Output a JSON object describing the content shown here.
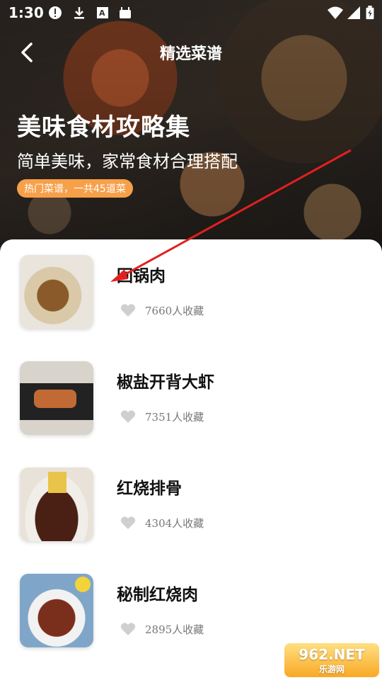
{
  "status_bar": {
    "time": "1:30"
  },
  "header": {
    "title": "精选菜谱",
    "hero_title": "美味食材攻略集",
    "hero_subtitle": "简单美味，家常食材合理搭配",
    "badge": "热门菜谱，一共45道菜"
  },
  "recipes": [
    {
      "name": "回锅肉",
      "favorites": "7660人收藏",
      "thumb_color": "#c9a36b"
    },
    {
      "name": "椒盐开背大虾",
      "favorites": "7351人收藏",
      "thumb_color": "#c26a35"
    },
    {
      "name": "红烧排骨",
      "favorites": "4304人收藏",
      "thumb_color": "#5a2a1e"
    },
    {
      "name": "秘制红烧肉",
      "favorites": "2895人收藏",
      "thumb_color": "#7a2f1c"
    }
  ],
  "watermark": {
    "top": "962.NET",
    "bottom": "乐游网"
  },
  "colors": {
    "badge": "#f7a04a",
    "arrow": "#e02020"
  }
}
